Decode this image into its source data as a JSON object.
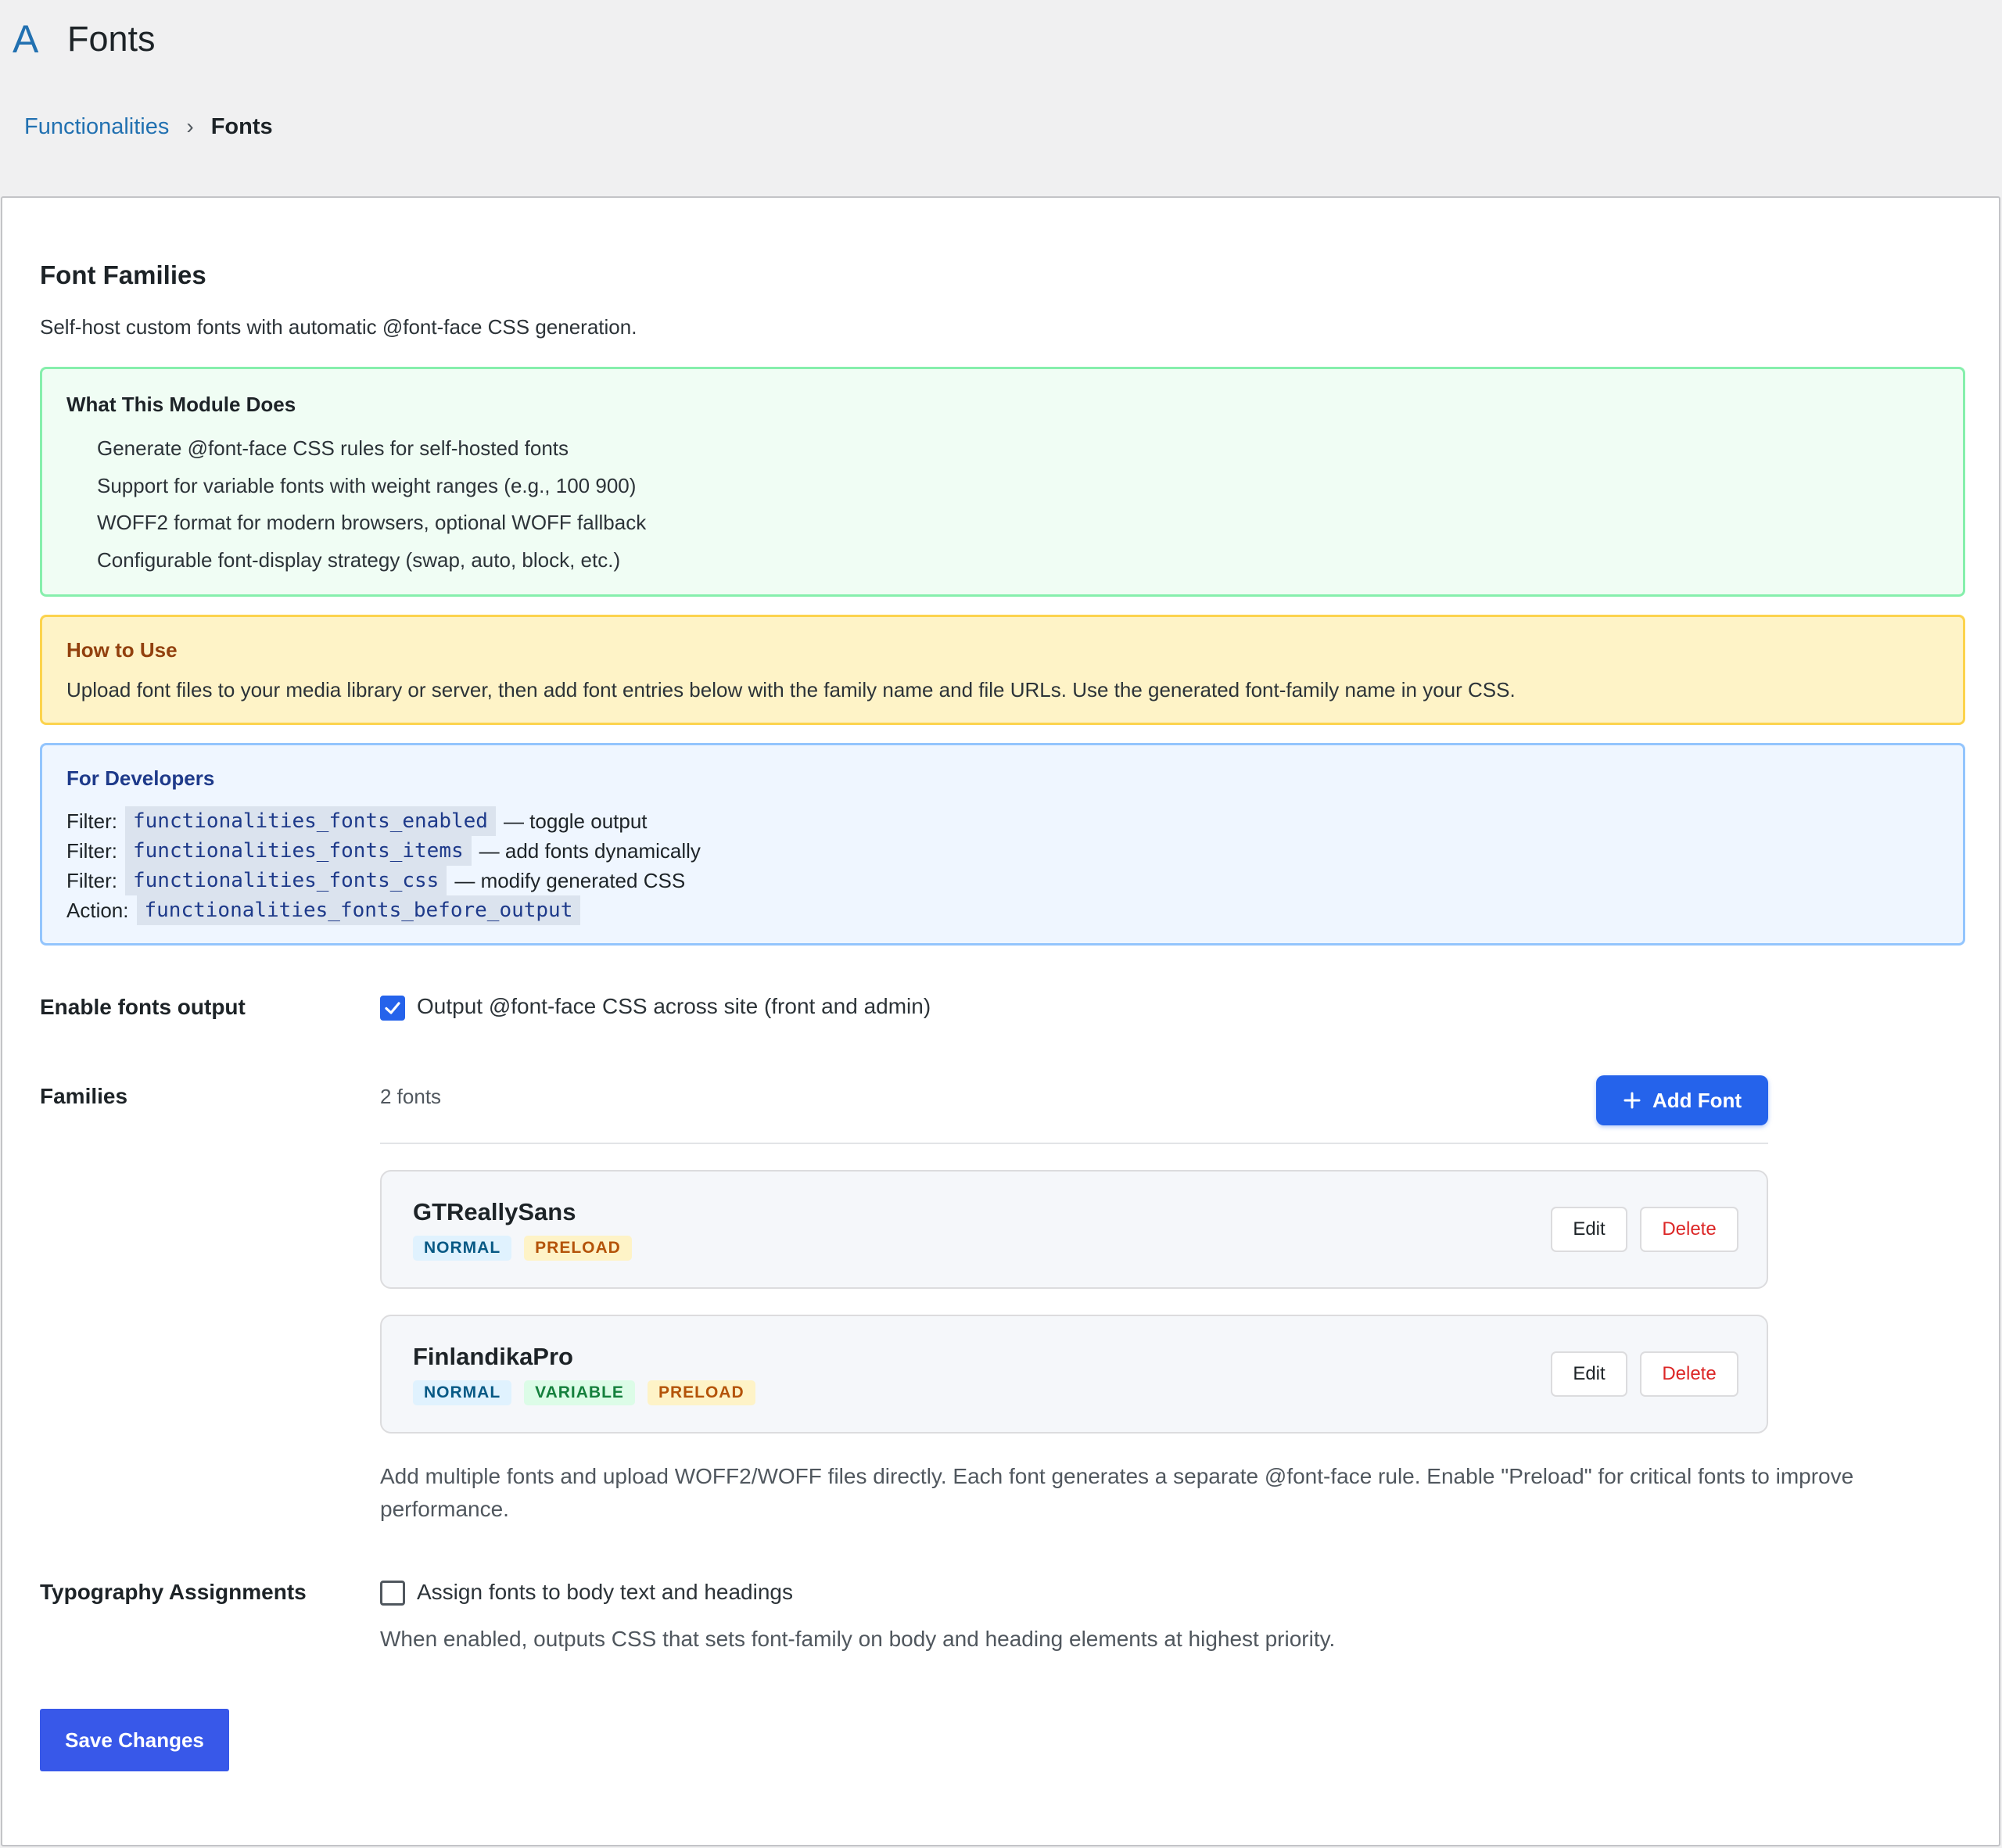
{
  "app": {
    "logo": "A",
    "title": "Fonts"
  },
  "breadcrumb": {
    "parent": "Functionalities",
    "separator": "›",
    "current": "Fonts"
  },
  "section": {
    "title": "Font Families",
    "description": "Self-host custom fonts with automatic @font-face CSS generation."
  },
  "info_box": {
    "heading": "What This Module Does",
    "items": [
      "Generate @font-face CSS rules for self-hosted fonts",
      "Support for variable fonts with weight ranges (e.g., 100 900)",
      "WOFF2 format for modern browsers, optional WOFF fallback",
      "Configurable font-display strategy (swap, auto, block, etc.)"
    ]
  },
  "usage_box": {
    "heading": "How to Use",
    "text": "Upload font files to your media library or server, then add font entries below with the family name and file URLs. Use the generated font-family name in your CSS."
  },
  "dev_box": {
    "heading": "For Developers",
    "lines": [
      {
        "type": "Filter:",
        "hook": "functionalities_fonts_enabled",
        "desc": "— toggle output"
      },
      {
        "type": "Filter:",
        "hook": "functionalities_fonts_items",
        "desc": "— add fonts dynamically"
      },
      {
        "type": "Filter:",
        "hook": "functionalities_fonts_css",
        "desc": "— modify generated CSS"
      },
      {
        "type": "Action:",
        "hook": "functionalities_fonts_before_output",
        "desc": ""
      }
    ]
  },
  "enable_output": {
    "label": "Enable fonts output",
    "checked": true,
    "checkbox_label": "Output @font-face CSS across site (front and admin)"
  },
  "families": {
    "label": "Families",
    "count": "2 fonts",
    "add_button": "Add Font",
    "items": [
      {
        "name": "GTReallySans",
        "badges": [
          "NORMAL",
          "PRELOAD"
        ],
        "edit": "Edit",
        "delete": "Delete"
      },
      {
        "name": "FinlandikaPro",
        "badges": [
          "NORMAL",
          "VARIABLE",
          "PRELOAD"
        ],
        "edit": "Edit",
        "delete": "Delete"
      }
    ],
    "help_line1": "Add multiple fonts and upload WOFF2/WOFF files directly. Each font generates a separate @font-face rule. Enable \"Preload\" for critical fonts to improve",
    "help_line2": "performance."
  },
  "typography": {
    "label": "Typography Assignments",
    "checked": false,
    "checkbox_label": "Assign fonts to body text and headings",
    "help": "When enabled, outputs CSS that sets font-family on body and heading elements at highest priority."
  },
  "save_button": "Save Changes",
  "colors": {
    "accent": "#2271b1",
    "primary_button": "#2563eb",
    "save_button": "#3858e9",
    "delete_text": "#dc2626"
  }
}
